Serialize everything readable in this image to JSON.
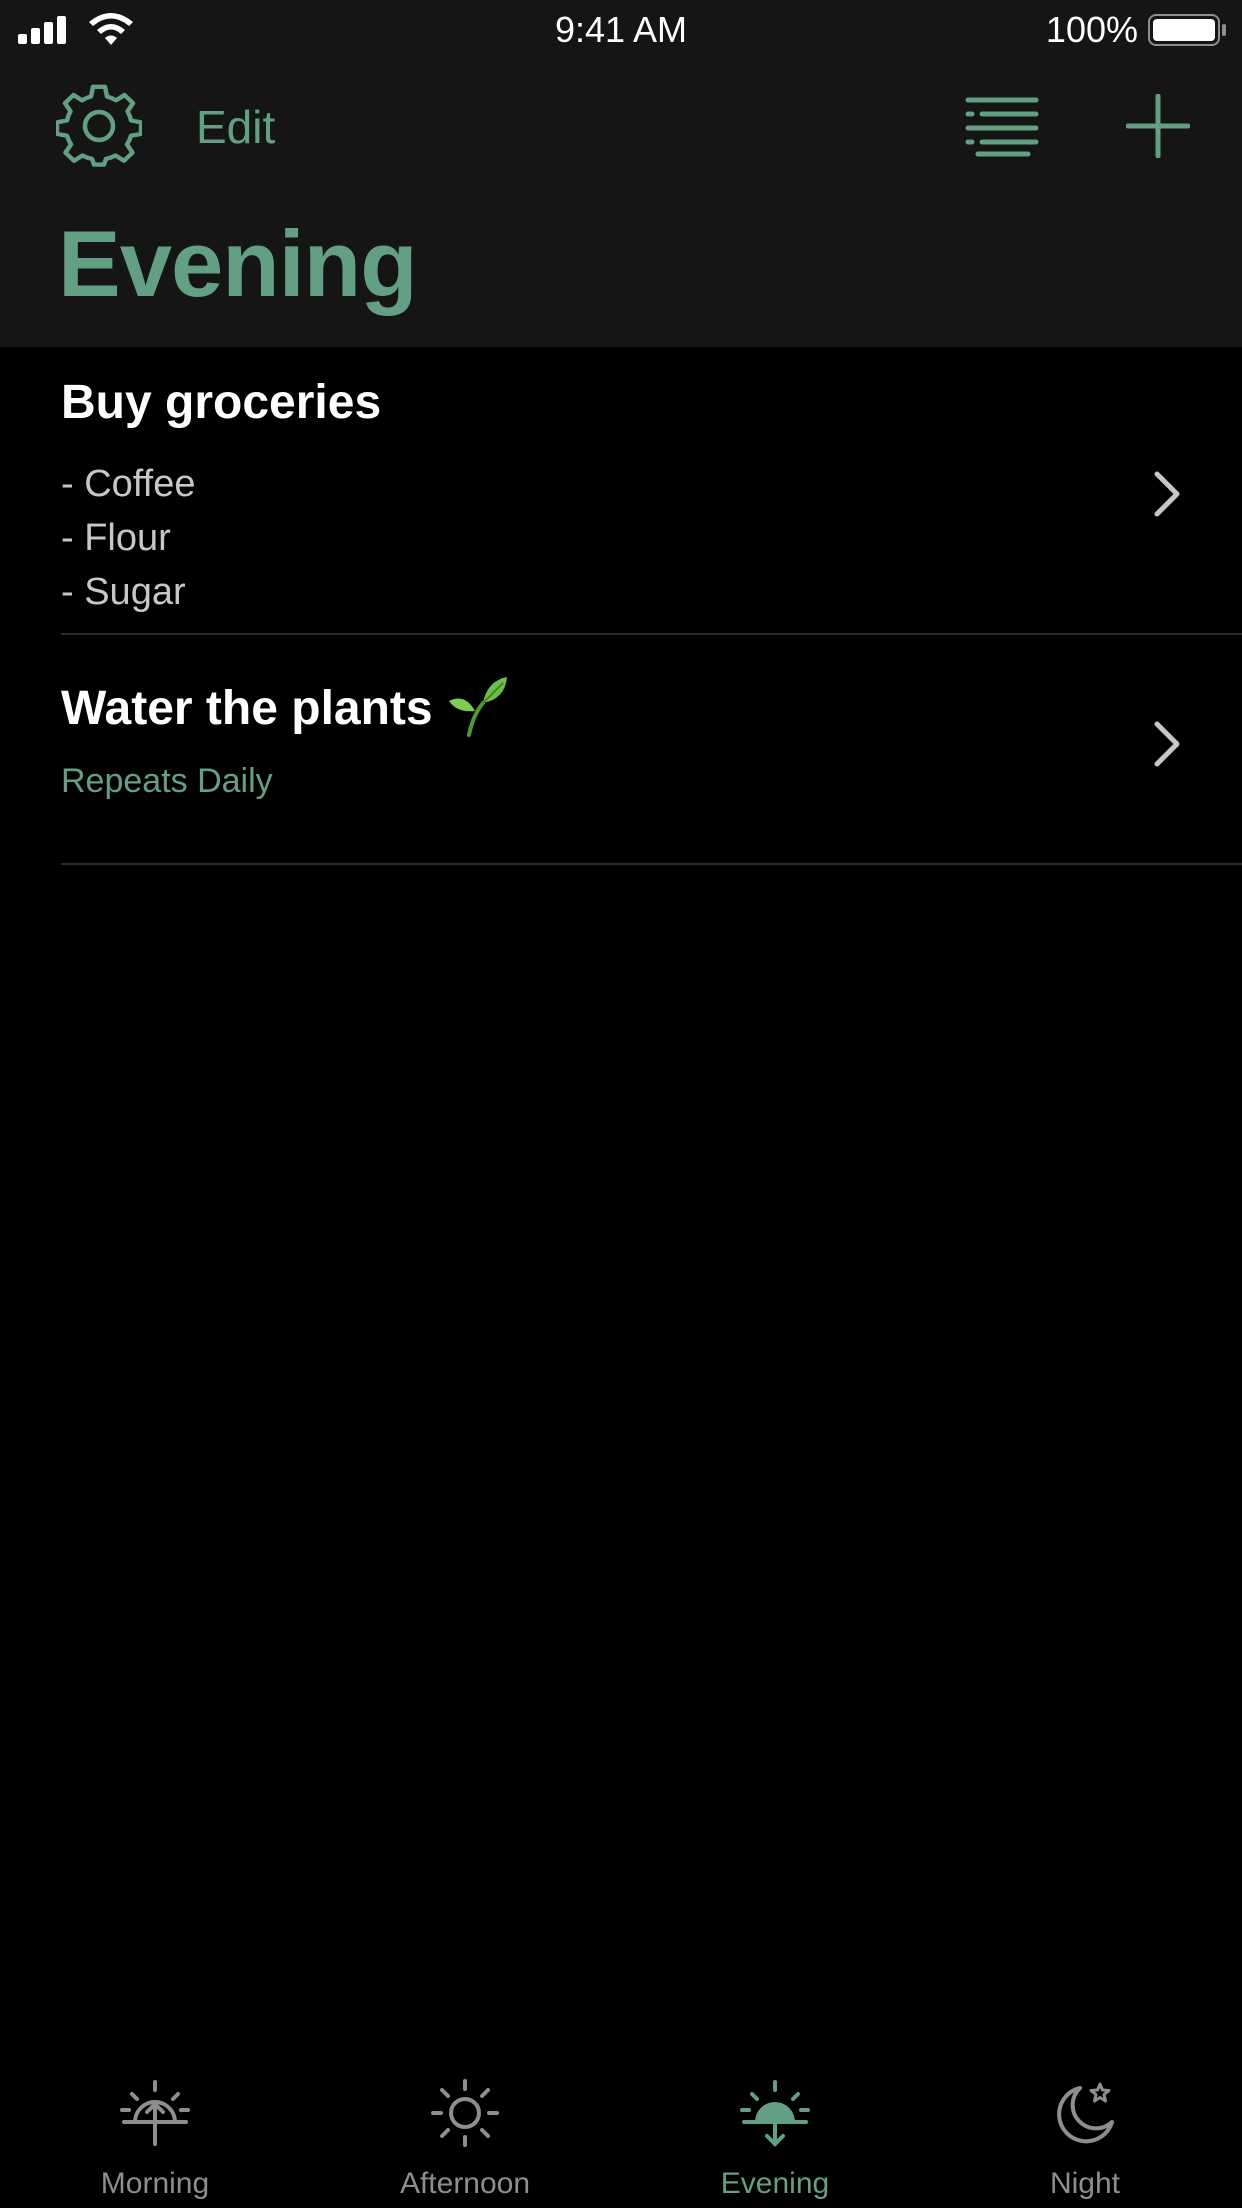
{
  "status_bar": {
    "time": "9:41 AM",
    "battery_percent": "100%",
    "battery_level": 1.0,
    "icons": [
      "cellular-signal-icon",
      "wifi-icon",
      "battery-icon"
    ]
  },
  "toolbar": {
    "settings_icon": "gear-icon",
    "edit_label": "Edit",
    "sort_icon": "list-sort-icon",
    "add_icon": "plus-icon"
  },
  "page": {
    "title": "Evening"
  },
  "tasks": [
    {
      "title": "Buy groceries",
      "notes": [
        "- Coffee",
        "- Flour",
        "- Sugar"
      ],
      "icon": "chevron-right-icon"
    },
    {
      "title": "Water the plants",
      "emoji_icon": "seedling-icon",
      "repeat": "Repeats Daily",
      "icon": "chevron-right-icon"
    }
  ],
  "tabs": [
    {
      "label": "Morning",
      "icon": "sunrise-icon",
      "active": false
    },
    {
      "label": "Afternoon",
      "icon": "sun-icon",
      "active": false
    },
    {
      "label": "Evening",
      "icon": "sunset-icon",
      "active": true
    },
    {
      "label": "Night",
      "icon": "moon-star-icon",
      "active": false
    }
  ],
  "colors": {
    "accent": "#63a083",
    "header_background": "#151515",
    "background": "#000000",
    "inactive_tab": "#8e8e8e",
    "note_text": "#c7c7c7"
  }
}
